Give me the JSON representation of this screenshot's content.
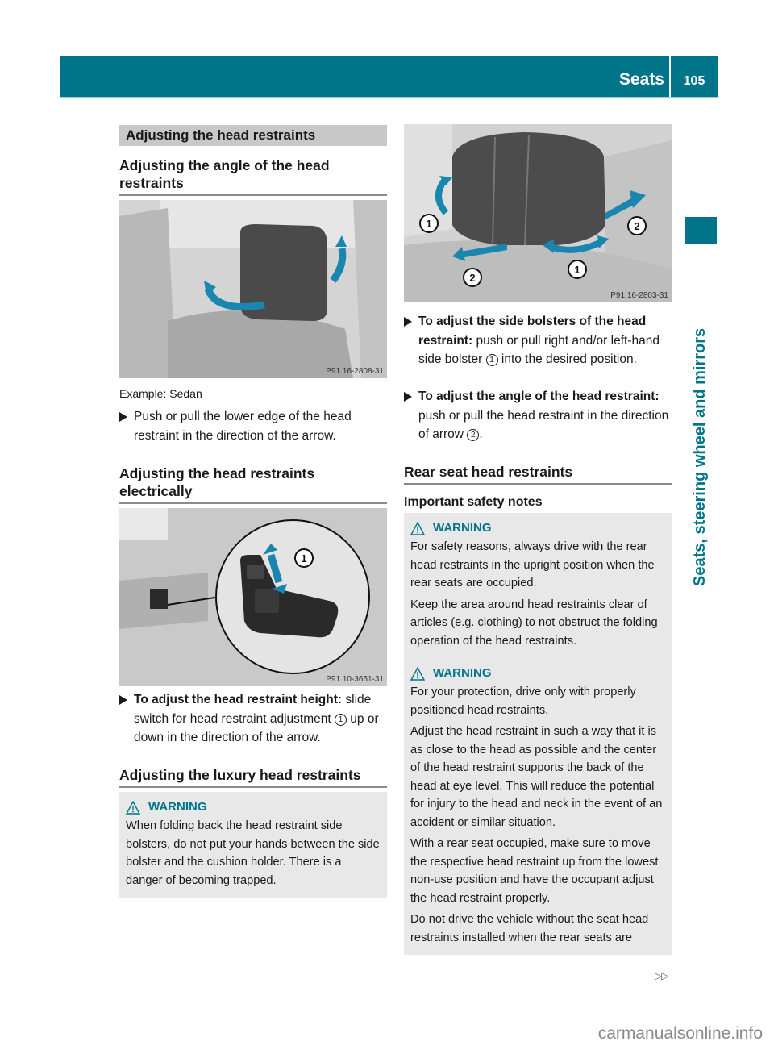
{
  "header": {
    "section_title": "Seats",
    "page_number": "105",
    "accent_color": "#00758a"
  },
  "side_tab": {
    "label": "Seats, steering wheel and mirrors"
  },
  "left_column": {
    "section_bar": "Adjusting the head restraints",
    "angle": {
      "heading": "Adjusting the angle of the head restraints",
      "figure_code": "P91.16-2808-31",
      "caption": "Example: Sedan",
      "bullet_text": "Push or pull the lower edge of the head restraint in the direction of the arrow."
    },
    "electric": {
      "heading": "Adjusting the head restraints electrically",
      "figure_code": "P91.10-3651-31",
      "figure_callout": "1",
      "bullet_bold": "To adjust the head restraint height:",
      "bullet_text_1": " slide switch for head restraint adjustment ",
      "bullet_ref": "1",
      "bullet_text_2": " up or down in the direction of the arrow."
    },
    "luxury": {
      "heading": "Adjusting the luxury head restraints",
      "warning": {
        "title": "WARNING",
        "paragraphs": [
          "When folding back the head restraint side bolsters, do not put your hands between the side bolster and the cushion holder. There is a danger of becoming trapped."
        ]
      }
    }
  },
  "right_column": {
    "figure_code": "P91.16-2803-31",
    "figure_callouts": [
      "1",
      "2",
      "1",
      "2"
    ],
    "bullets": [
      {
        "bold": "To adjust the side bolsters of the head restraint:",
        "text_1": " push or pull right and/or left-hand side bolster ",
        "ref": "1",
        "text_2": " into the desired position."
      },
      {
        "bold": "To adjust the angle of the head restraint:",
        "text_1": " push or pull the head restraint in the direction of arrow ",
        "ref": "2",
        "text_2": "."
      }
    ],
    "rear": {
      "heading": "Rear seat head restraints",
      "subheading": "Important safety notes",
      "warning_1": {
        "title": "WARNING",
        "paragraphs": [
          "For safety reasons, always drive with the rear head restraints in the upright position when the rear seats are occupied.",
          "Keep the area around head restraints clear of articles (e.g. clothing) to not obstruct the folding operation of the head restraints."
        ]
      },
      "warning_2": {
        "title": "WARNING",
        "paragraphs": [
          "For your protection, drive only with properly positioned head restraints.",
          "Adjust the head restraint in such a way that it is as close to the head as possible and the center of the head restraint supports the back of the head at eye level. This will reduce the potential for injury to the head and neck in the event of an accident or similar situation.",
          "With a rear seat occupied, make sure to move the respective head restraint up from the lowest non-use position and have the occupant adjust the head restraint properly.",
          "Do not drive the vehicle without the seat head restraints installed when the rear seats are"
        ]
      }
    }
  },
  "footer": {
    "continue_marker": "▷▷",
    "watermark": "carmanualsonline.info"
  }
}
